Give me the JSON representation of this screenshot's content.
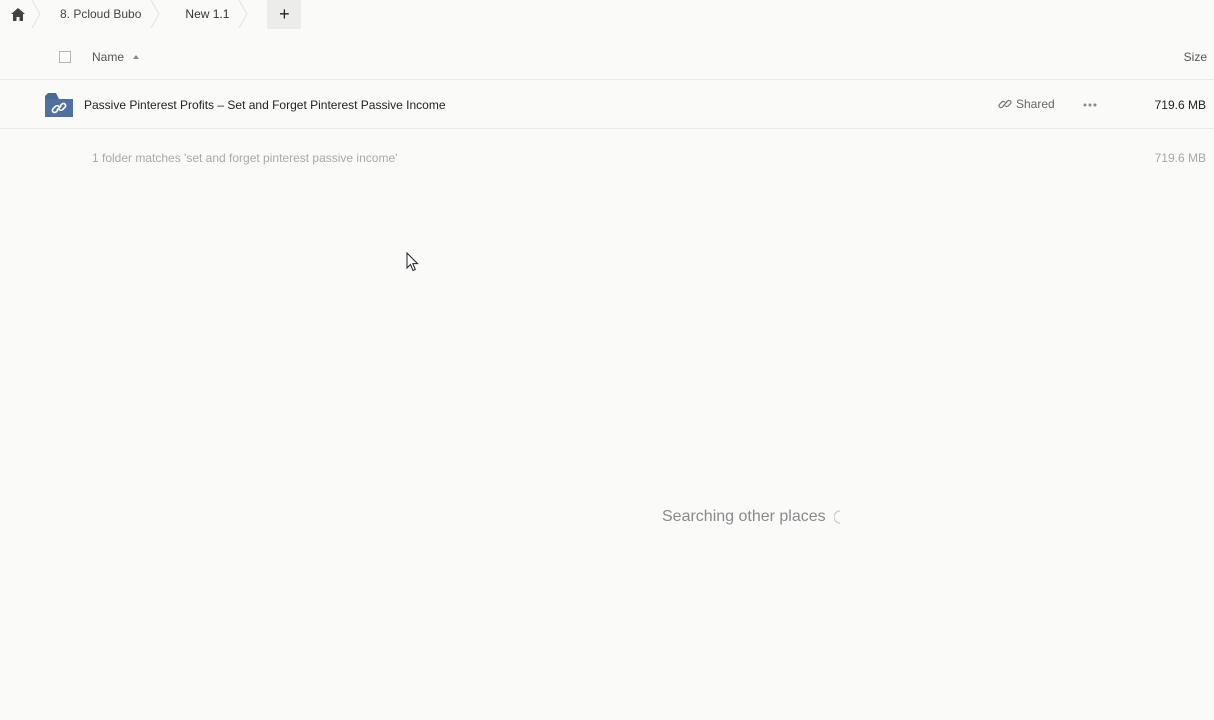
{
  "breadcrumb": {
    "home_icon": "home-icon",
    "items": [
      {
        "label": "8. Pcloud Bubo"
      },
      {
        "label": "New 1.1"
      }
    ],
    "add_label": "+"
  },
  "table": {
    "headers": {
      "name": "Name",
      "size": "Size"
    },
    "rows": [
      {
        "name": "Passive Pinterest Profits – Set and Forget Pinterest Passive Income",
        "icon": "shared-folder-icon",
        "shared_label": "Shared",
        "size": "719.6 MB"
      }
    ]
  },
  "summary": {
    "text": "1 folder matches 'set and forget pinterest passive income'",
    "size": "719.6 MB"
  },
  "search_status": "Searching other places",
  "colors": {
    "folder": "#4a6a96",
    "background": "#fafaf9",
    "muted_text": "#a8a8a8"
  }
}
